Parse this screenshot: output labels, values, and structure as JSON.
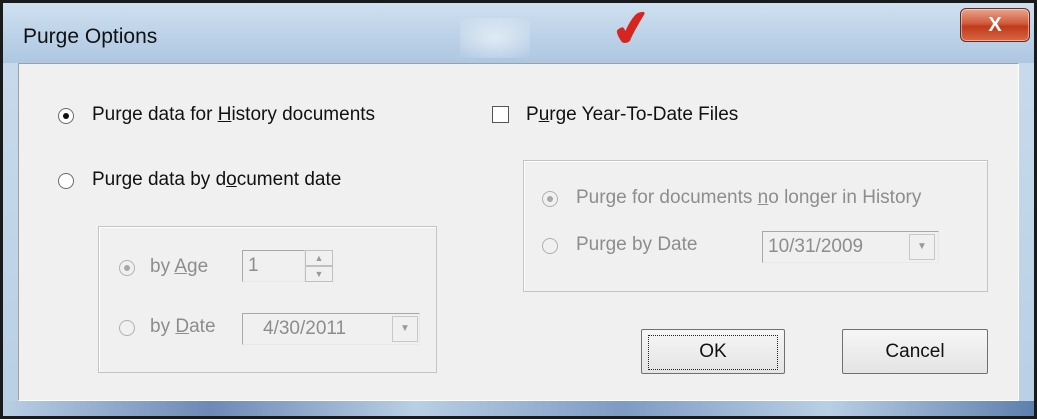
{
  "window": {
    "title": "Purge Options",
    "close_label": "X",
    "decor_check": "✔"
  },
  "options": {
    "purge_history": {
      "pre": "Purge data for ",
      "key": "H",
      "post": "istory documents",
      "checked": true
    },
    "purge_by_date": {
      "pre": "Purge data by d",
      "key": "o",
      "post": "cument date",
      "checked": false
    }
  },
  "by_date_group": {
    "by_age": {
      "pre": "by ",
      "key": "A",
      "post": "ge",
      "value": "1",
      "checked": true
    },
    "by_date": {
      "pre": "by ",
      "key": "D",
      "post": "ate",
      "value": "4/30/2011",
      "checked": false
    }
  },
  "ytd": {
    "checkbox": {
      "pre": "P",
      "key": "u",
      "post": "rge Year-To-Date Files",
      "checked": false
    },
    "no_longer": {
      "pre": "Purge for documents ",
      "key": "n",
      "post": "o longer in History",
      "checked": true
    },
    "purge_by_date": {
      "label": "Purge by Date",
      "value": "10/31/2009",
      "checked": false
    }
  },
  "buttons": {
    "ok": "OK",
    "cancel": "Cancel"
  },
  "icons": {
    "dropdown": "▼",
    "spin_up": "▲",
    "spin_down": "▼"
  }
}
